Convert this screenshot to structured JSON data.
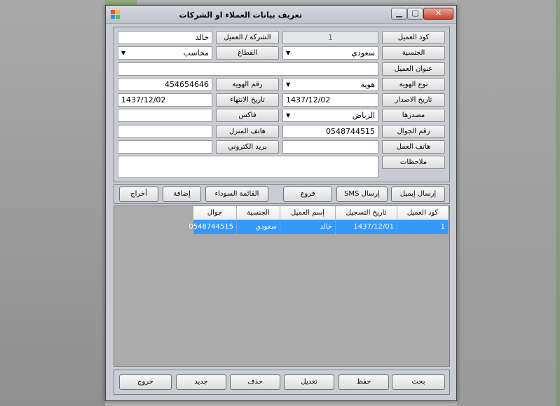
{
  "window": {
    "title": "تعريف بيانات العملاء او الشركات"
  },
  "form": {
    "customer_code": {
      "label": "كود العميل",
      "value": "1"
    },
    "company_customer": {
      "label": "الشركة / العميل",
      "value": "خالد"
    },
    "nationality": {
      "label": "الجنسية",
      "value": "سعودي"
    },
    "sector": {
      "label": "القطاع",
      "value": "محاسب"
    },
    "customer_address": {
      "label": "عنوان العميل",
      "value": ""
    },
    "id_type": {
      "label": "نوع الهوية",
      "value": "هوية"
    },
    "id_number": {
      "label": "رقم الهوية",
      "value": "454654646"
    },
    "issue_date": {
      "label": "تاريخ الاصدار",
      "value": "1437/12/02"
    },
    "expiry_date": {
      "label": "تاريخ الانتهاء",
      "value": "1437/12/02"
    },
    "source": {
      "label": "مصدرها",
      "value": "الرياض"
    },
    "fax": {
      "label": "فاكس",
      "value": ""
    },
    "mobile": {
      "label": "رقم الجوال",
      "value": "0548744515"
    },
    "home_phone": {
      "label": "هاتف المنزل",
      "value": ""
    },
    "work_phone": {
      "label": "هاتف العمل",
      "value": ""
    },
    "email": {
      "label": "بريد الكتروني",
      "value": ""
    },
    "notes": {
      "label": "ملاحظات",
      "value": ""
    }
  },
  "action_bar": {
    "send_email": "إرسال إيميل",
    "send_sms": "إرسال SMS",
    "branches": "فروع",
    "blacklist": "القائمة السوداء",
    "add": "إضافة",
    "output": "أخراج"
  },
  "grid": {
    "columns": [
      "كود العميل",
      "تاريخ التسجيل",
      "إسم العميل",
      "الجنسية",
      "جوال"
    ],
    "rows": [
      {
        "code": "1",
        "reg_date": "1437/12/01",
        "name": "خالد",
        "nationality": "سعودي",
        "mobile": "0548744515"
      }
    ]
  },
  "bottom_bar": {
    "search": "بحث",
    "save": "حفظ",
    "edit": "تعديل",
    "delete": "حذف",
    "new": "جديد",
    "exit": "خروج"
  }
}
